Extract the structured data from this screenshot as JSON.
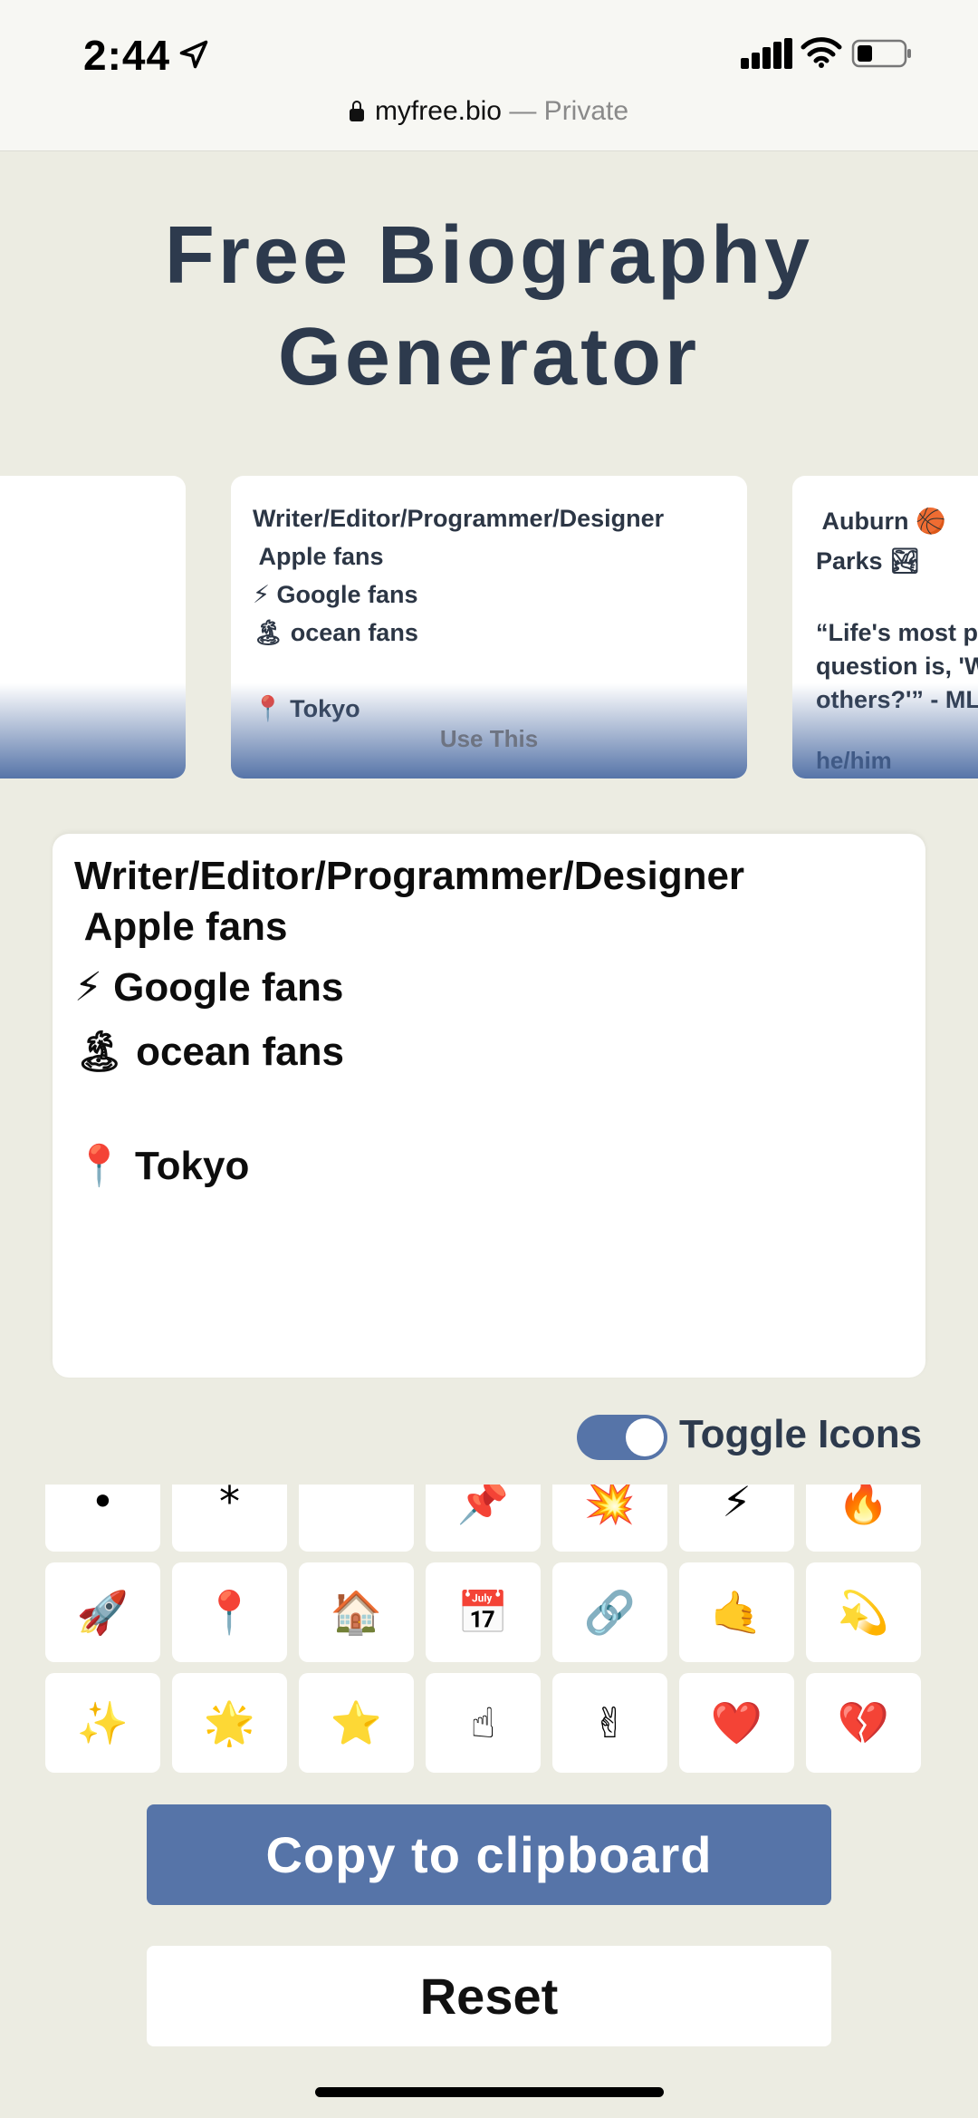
{
  "status_bar": {
    "time": "2:44",
    "url": "myfree.bio",
    "url_suffix": "— Private"
  },
  "page": {
    "title_line1": "Free Biography",
    "title_line2": "Generator"
  },
  "carousel": {
    "center_card": {
      "text": "Writer/Editor/Programmer/Designer\n Apple fans\n⚡ Google fans\n🏝 ocean fans\n\n📍 Tokyo",
      "button": "Use This"
    },
    "right_card": {
      "line1": " Auburn 🏀\nParks 🏞",
      "line2": "“Life's most p\nquestion is, 'W\nothers?'” - ML",
      "pronouns": "he/him"
    }
  },
  "bio": {
    "lines": [
      "Writer/Editor/Programmer/Designer",
      " Apple fans",
      "⚡ Google fans",
      "🏝 ocean fans",
      "",
      "📍 Tokyo"
    ]
  },
  "toggle": {
    "label": "Toggle Icons",
    "state": "on"
  },
  "emoji_rows": [
    [
      "•",
      "*",
      "",
      "📌",
      "💥",
      "⚡",
      "🔥"
    ],
    [
      "🚀",
      "📍",
      "🏠",
      "📅",
      "🔗",
      "🤙",
      "💫"
    ],
    [
      "✨",
      "🌟",
      "⭐",
      "☝",
      "✌",
      "❤️",
      "💔"
    ]
  ],
  "buttons": {
    "copy": "Copy to clipboard",
    "reset": "Reset"
  },
  "colors": {
    "background": "#ecece2",
    "accent": "#5674a8",
    "title": "#2d3a4d"
  }
}
